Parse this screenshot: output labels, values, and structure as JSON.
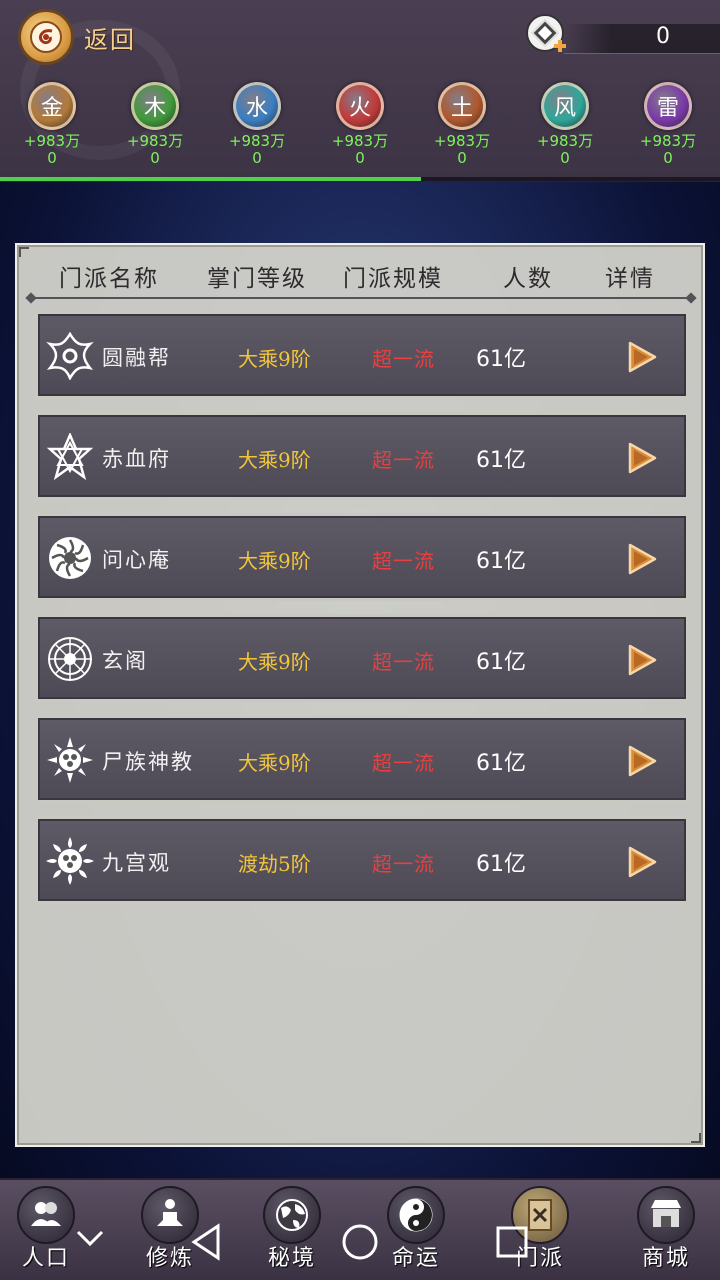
{
  "header": {
    "back_label": "返回",
    "currency_value": "0",
    "progress_fraction": 0.585,
    "elements": [
      {
        "glyph": "金",
        "bonus": "+983万",
        "count": "0",
        "color": "#b37a3a"
      },
      {
        "glyph": "木",
        "bonus": "+983万",
        "count": "0",
        "color": "#3f9a3a"
      },
      {
        "glyph": "水",
        "bonus": "+983万",
        "count": "0",
        "color": "#3a7fc2"
      },
      {
        "glyph": "火",
        "bonus": "+983万",
        "count": "0",
        "color": "#c23a3a"
      },
      {
        "glyph": "土",
        "bonus": "+983万",
        "count": "0",
        "color": "#b0582e"
      },
      {
        "glyph": "风",
        "bonus": "+983万",
        "count": "0",
        "color": "#2fa79a"
      },
      {
        "glyph": "雷",
        "bonus": "+983万",
        "count": "0",
        "color": "#7a3aa8"
      }
    ]
  },
  "table": {
    "columns": [
      "门派名称",
      "掌门等级",
      "门派规模",
      "人数",
      "详情"
    ],
    "rows": [
      {
        "name": "圆融帮",
        "rank": "大乘9阶",
        "scale": "超一流",
        "count": "61亿",
        "emblem": "shuriken-emblem-icon"
      },
      {
        "name": "赤血府",
        "rank": "大乘9阶",
        "scale": "超一流",
        "count": "61亿",
        "emblem": "star-emblem-icon"
      },
      {
        "name": "问心庵",
        "rank": "大乘9阶",
        "scale": "超一流",
        "count": "61亿",
        "emblem": "lotus-emblem-icon"
      },
      {
        "name": "玄阁",
        "rank": "大乘9阶",
        "scale": "超一流",
        "count": "61亿",
        "emblem": "wheel-emblem-icon"
      },
      {
        "name": "尸族神教",
        "rank": "大乘9阶",
        "scale": "超一流",
        "count": "61亿",
        "emblem": "sun-emblem-icon"
      },
      {
        "name": "九宫观",
        "rank": "渡劫5阶",
        "scale": "超一流",
        "count": "61亿",
        "emblem": "flame-emblem-icon"
      }
    ]
  },
  "nav": {
    "items": [
      {
        "label": "人口",
        "icon": "population-icon"
      },
      {
        "label": "修炼",
        "icon": "meditation-icon"
      },
      {
        "label": "秘境",
        "icon": "globe-icon"
      },
      {
        "label": "命运",
        "icon": "yinyang-icon"
      },
      {
        "label": "门派",
        "icon": "sect-scroll-icon"
      },
      {
        "label": "商城",
        "icon": "shop-icon"
      }
    ]
  },
  "colors": {
    "rank": "#f3c63a",
    "scale": "#e64040",
    "bonus": "#7ef35a",
    "accent_progress": "#4fd24a"
  }
}
